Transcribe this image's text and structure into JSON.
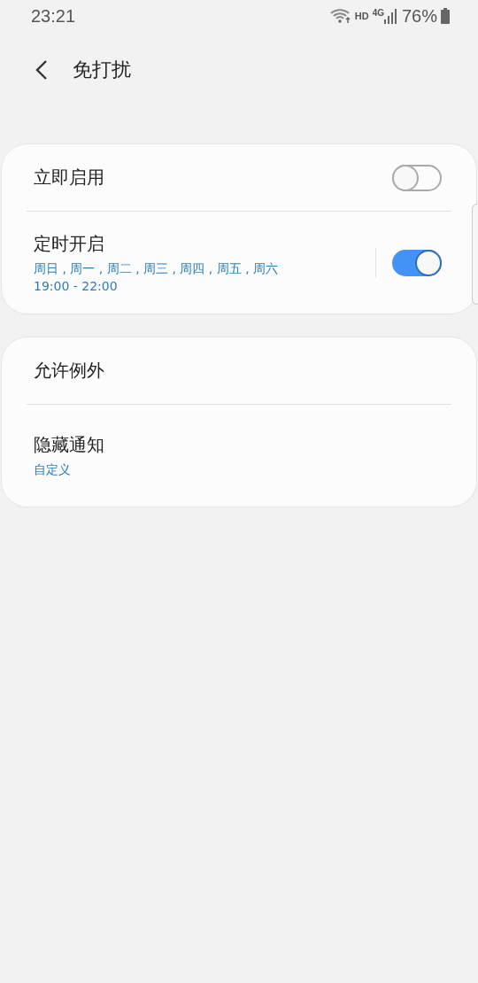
{
  "status_bar": {
    "time": "23:21",
    "network_label": "HD",
    "network_type": "4G",
    "battery": "76%"
  },
  "header": {
    "title": "免打扰"
  },
  "cards": [
    {
      "items": [
        {
          "kind": "toggle",
          "title": "立即启用",
          "on": false
        },
        {
          "kind": "toggle",
          "title": "定时开启",
          "details": [
            "周日 , 周一 , 周二 , 周三 , 周四 , 周五 , 周六",
            "19:00 - 22:00"
          ],
          "on": true
        }
      ]
    },
    {
      "items": [
        {
          "kind": "link",
          "title": "允许例外"
        },
        {
          "kind": "link",
          "title": "隐藏通知",
          "details": [
            "自定义"
          ]
        }
      ]
    }
  ]
}
